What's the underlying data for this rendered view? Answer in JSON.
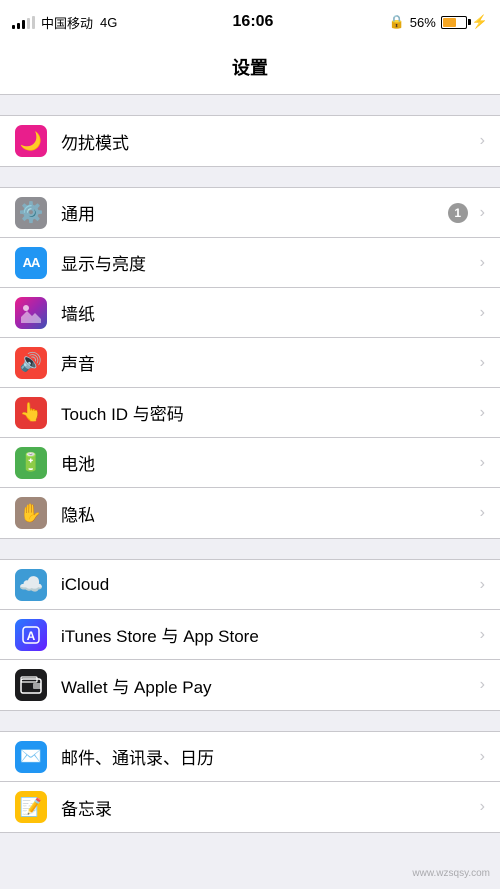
{
  "statusBar": {
    "carrier": "中国移动",
    "network": "4G",
    "time": "16:06",
    "battery": "56%",
    "lockIcon": "🔒",
    "chargeIcon": "⚡"
  },
  "pageTitle": "设置",
  "sections": [
    {
      "id": "section-dnd",
      "rows": [
        {
          "id": "dnd",
          "label": "勿扰模式",
          "iconBg": "bg-pink",
          "icon": "🌙",
          "badge": null
        }
      ]
    },
    {
      "id": "section-display",
      "rows": [
        {
          "id": "general",
          "label": "通用",
          "iconBg": "bg-gray",
          "icon": "⚙️",
          "badge": "1",
          "badgeColor": "gray"
        },
        {
          "id": "display",
          "label": "显示与亮度",
          "iconBg": "bg-blue",
          "icon": "AA",
          "badge": null,
          "iconFont": "14px"
        },
        {
          "id": "wallpaper",
          "label": "墙纸",
          "iconBg": "bg-pink",
          "icon": "✿",
          "badge": null
        },
        {
          "id": "sounds",
          "label": "声音",
          "iconBg": "bg-red",
          "icon": "🔊",
          "badge": null
        },
        {
          "id": "touchid",
          "label": "Touch ID 与密码",
          "iconBg": "bg-red2",
          "icon": "👆",
          "badge": null
        },
        {
          "id": "battery",
          "label": "电池",
          "iconBg": "bg-green",
          "icon": "🔋",
          "badge": null
        },
        {
          "id": "privacy",
          "label": "隐私",
          "iconBg": "bg-tan",
          "icon": "✋",
          "badge": null
        }
      ]
    },
    {
      "id": "section-accounts",
      "rows": [
        {
          "id": "icloud",
          "label": "iCloud",
          "iconBg": "bg-icloud",
          "icon": "☁️",
          "badge": null
        },
        {
          "id": "itunes",
          "label": "iTunes Store 与 App Store",
          "iconBg": "bg-itunes",
          "icon": "🅐",
          "badge": null
        },
        {
          "id": "wallet",
          "label": "Wallet 与 Apple Pay",
          "iconBg": "bg-wallet",
          "icon": "💳",
          "badge": null
        }
      ]
    },
    {
      "id": "section-apps",
      "rows": [
        {
          "id": "mail",
          "label": "邮件、通讯录、日历",
          "iconBg": "bg-mail",
          "icon": "✉️",
          "badge": null
        },
        {
          "id": "notes",
          "label": "备忘录",
          "iconBg": "bg-notes",
          "icon": "📝",
          "badge": null
        }
      ]
    }
  ],
  "watermark": "www.wzsqsy.com"
}
